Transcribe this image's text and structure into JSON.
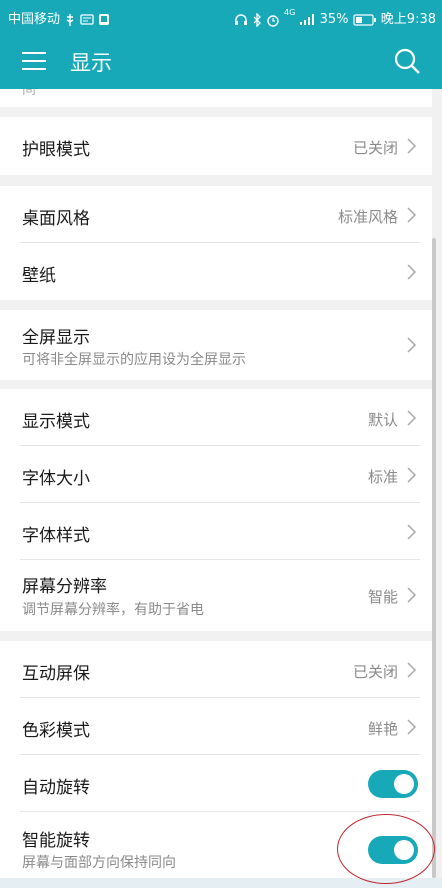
{
  "status_bar": {
    "carrier": "中国移动",
    "battery": "35%",
    "time": "晚上9:38",
    "network": "4G"
  },
  "app_bar": {
    "title": "显示"
  },
  "partial_top_text": "间",
  "items": {
    "eye_comfort": {
      "label": "护眼模式",
      "value": "已关闭"
    },
    "desktop_style": {
      "label": "桌面风格",
      "value": "标准风格"
    },
    "wallpaper": {
      "label": "壁纸"
    },
    "fullscreen": {
      "label": "全屏显示",
      "sub": "可将非全屏显示的应用设为全屏显示"
    },
    "display_mode": {
      "label": "显示模式",
      "value": "默认"
    },
    "font_size": {
      "label": "字体大小",
      "value": "标准"
    },
    "font_style": {
      "label": "字体样式"
    },
    "resolution": {
      "label": "屏幕分辨率",
      "sub": "调节屏幕分辨率，有助于省电",
      "value": "智能"
    },
    "screensaver": {
      "label": "互动屏保",
      "value": "已关闭"
    },
    "color_mode": {
      "label": "色彩模式",
      "value": "鲜艳"
    },
    "auto_rotate": {
      "label": "自动旋转",
      "enabled": true
    },
    "smart_rotate": {
      "label": "智能旋转",
      "sub": "屏幕与面部方向保持同向",
      "enabled": true
    }
  },
  "colors": {
    "accent": "#17a9b8",
    "background": "#f1f1f1",
    "annotation": "#c0272d"
  },
  "icons": [
    "wifi-icon",
    "usb-icon",
    "message-icon",
    "headset-icon",
    "bluetooth-icon",
    "alarm-icon",
    "signal-icon",
    "battery-icon",
    "menu-icon",
    "search-icon",
    "chevron-right-icon"
  ]
}
